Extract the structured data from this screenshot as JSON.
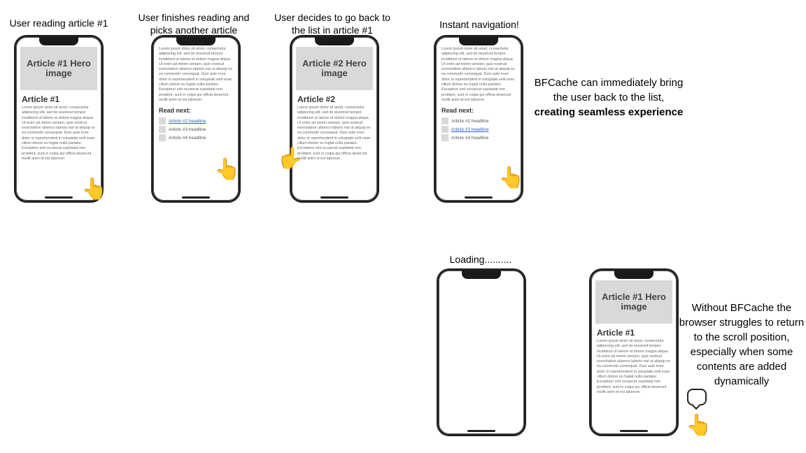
{
  "captions": {
    "c1": "User reading article #1",
    "c2": "User finishes reading and picks another article",
    "c3": "User decides to go back to the list in article #1",
    "c4": "Instant navigation!",
    "c5": "Loading.........."
  },
  "side": {
    "good_1": "BFCache can immediately bring the user back to the list,",
    "good_bold": "creating seamless experience",
    "bad": "Without BFCache the browser struggles to return to the scroll position, especially when some contents are added dynamically"
  },
  "phone": {
    "hero1": "Article #1 Hero image",
    "hero2": "Article #2 Hero image",
    "title1": "Article #1",
    "title2": "Article #2",
    "lorem": "Lorem ipsum dolor sit amet, consectetur adipiscing elit, sed do eiusmod tempor incididunt ut labore et dolore magna aliqua. Ut enim ad minim veniam, quis nostrud exercitation ullamco laboris nisi ut aliquip ex ea commodo consequat. Duis aute irure dolor in reprehenderit in voluptate velit esse cillum dolore eu fugiat nulla pariatur. Excepteur sint occaecat cupidatat non proident, sunt in culpa qui officia deserunt mollit anim id est laborum.",
    "readnext": "Read next:",
    "link2": "Article #2 headline",
    "link3": "Article #3 headline",
    "link4": "Article #4 headline"
  }
}
